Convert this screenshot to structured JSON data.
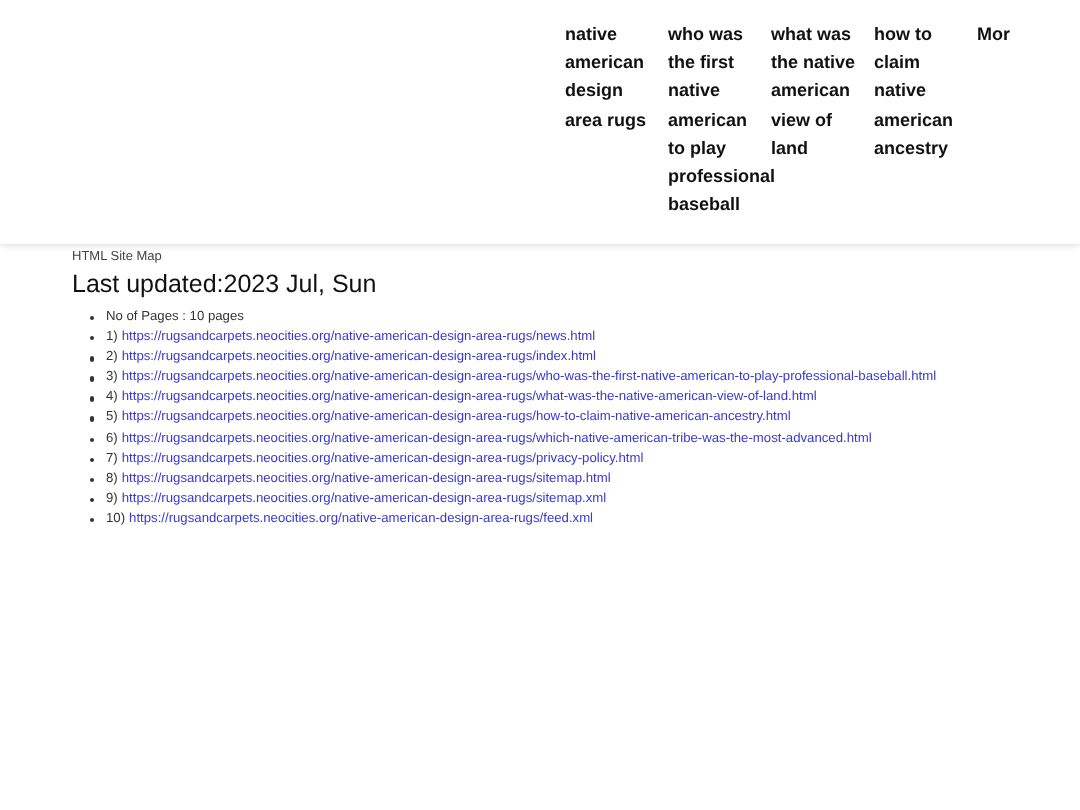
{
  "nav": {
    "items": [
      {
        "label": "native american design area rugs"
      },
      {
        "label": "who was the first native american to play professional baseball"
      },
      {
        "label": "what was the native american view of land"
      },
      {
        "label": "how to claim native american ancestry"
      },
      {
        "label": "Mor"
      }
    ]
  },
  "sitemap": {
    "caption": "HTML Site Map",
    "heading": "Last updated:2023 Jul, Sun",
    "count": "No of Pages : 10 pages",
    "links": [
      {
        "number": "1)",
        "url": "https://rugsandcarpets.neocities.org/native-american-design-area-rugs/news.html"
      },
      {
        "number": "2)",
        "url": "https://rugsandcarpets.neocities.org/native-american-design-area-rugs/index.html"
      },
      {
        "number": "3)",
        "url": "https://rugsandcarpets.neocities.org/native-american-design-area-rugs/who-was-the-first-native-american-to-play-professional-baseball.html"
      },
      {
        "number": "4)",
        "url": "https://rugsandcarpets.neocities.org/native-american-design-area-rugs/what-was-the-native-american-view-of-land.html"
      },
      {
        "number": "5)",
        "url": "https://rugsandcarpets.neocities.org/native-american-design-area-rugs/how-to-claim-native-american-ancestry.html"
      },
      {
        "number": "6)",
        "url": "https://rugsandcarpets.neocities.org/native-american-design-area-rugs/which-native-american-tribe-was-the-most-advanced.html"
      },
      {
        "number": "7)",
        "url": "https://rugsandcarpets.neocities.org/native-american-design-area-rugs/privacy-policy.html"
      },
      {
        "number": "8)",
        "url": "https://rugsandcarpets.neocities.org/native-american-design-area-rugs/sitemap.html"
      },
      {
        "number": "9)",
        "url": "https://rugsandcarpets.neocities.org/native-american-design-area-rugs/sitemap.xml"
      },
      {
        "number": "10)",
        "url": "https://rugsandcarpets.neocities.org/native-american-design-area-rugs/feed.xml"
      }
    ]
  }
}
